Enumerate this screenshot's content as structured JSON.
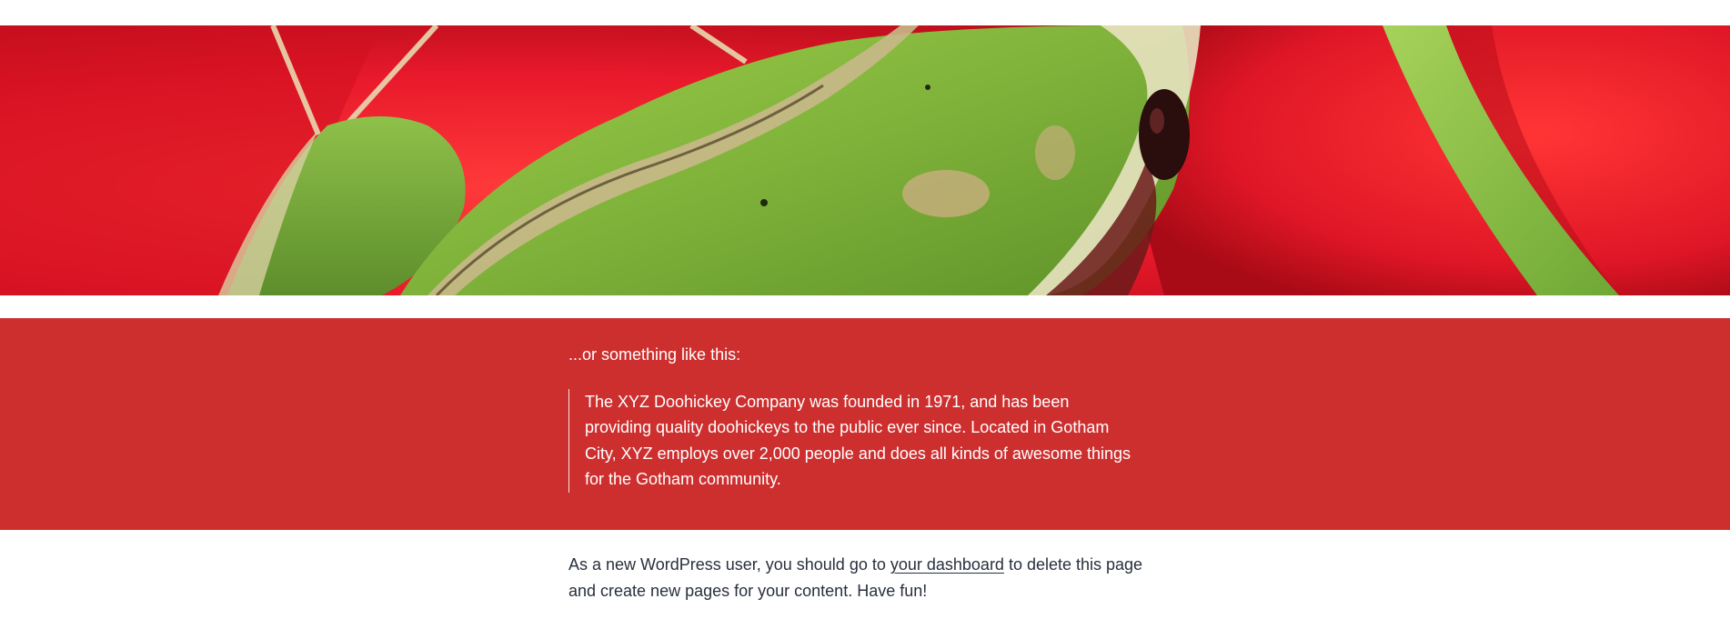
{
  "theme": {
    "cover_bg": "#cd2f2f",
    "text_color": "#28303d",
    "hero_red": "#e0182a",
    "frog_green": "#7fb23a"
  },
  "hero": {
    "icon": "frog-photo-image"
  },
  "cover": {
    "intro": "...or something like this:",
    "quote": "The XYZ Doohickey Company was founded in 1971, and has been providing quality doohickeys to the public ever since. Located in Gotham City, XYZ employs over 2,000 people and does all kinds of awesome things for the Gotham community."
  },
  "body": {
    "text_before": "As a new WordPress user, you should go to ",
    "link_label": "your dashboard",
    "text_after": " to delete this page and create new pages for your content. Have fun!"
  }
}
